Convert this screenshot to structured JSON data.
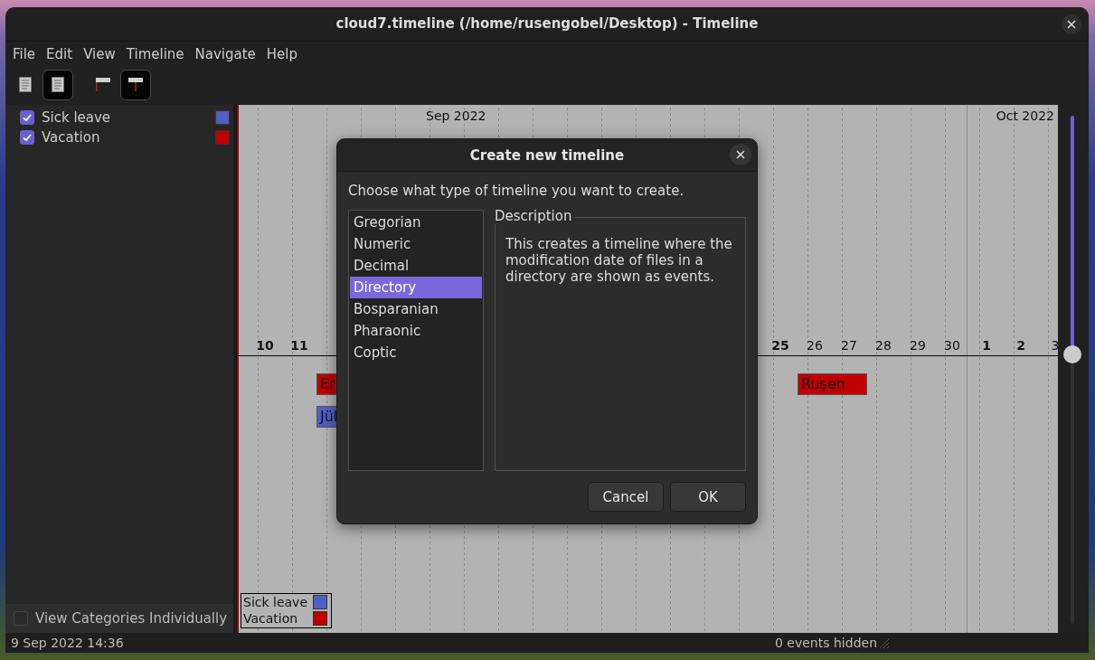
{
  "window": {
    "title": "cloud7.timeline (/home/rusengobel/Desktop) - Timeline"
  },
  "menu": [
    "File",
    "Edit",
    "View",
    "Timeline",
    "Navigate",
    "Help"
  ],
  "toolbar": [
    {
      "kind": "page",
      "pressed": false
    },
    {
      "kind": "page",
      "pressed": true
    },
    {
      "kind": "flag-left",
      "pressed": false
    },
    {
      "kind": "flag-center",
      "pressed": true
    }
  ],
  "categories": [
    {
      "name": "Sick leave",
      "checked": true,
      "color": "#5060c4"
    },
    {
      "name": "Vacation",
      "checked": true,
      "color": "#c00000"
    }
  ],
  "view_individually": {
    "label": "View Categories Individually",
    "checked": false
  },
  "timeline": {
    "months": [
      "Sep 2022",
      "Oct 2022"
    ],
    "days": [
      {
        "label": "10",
        "weekend": true
      },
      {
        "label": "11",
        "weekend": true
      },
      {
        "label": "25",
        "weekend": true
      },
      {
        "label": "26",
        "weekend": false
      },
      {
        "label": "27",
        "weekend": false
      },
      {
        "label": "28",
        "weekend": false
      },
      {
        "label": "29",
        "weekend": false
      },
      {
        "label": "30",
        "weekend": false
      },
      {
        "label": "1",
        "weekend": true
      },
      {
        "label": "2",
        "weekend": true
      },
      {
        "label": "3",
        "weekend": false
      }
    ],
    "events": [
      {
        "text": "Er",
        "color": "#c00000"
      },
      {
        "text": "Jül",
        "color": "#5060c4"
      },
      {
        "text": "Ruşen",
        "color": "#c00000"
      }
    ],
    "legend": [
      {
        "name": "Sick leave",
        "color": "#5060c4"
      },
      {
        "name": "Vacation",
        "color": "#c00000"
      }
    ]
  },
  "zoom": {
    "level": 0.47
  },
  "status_bar": {
    "left": "9 Sep 2022 14:36",
    "right": "0 events hidden"
  },
  "dialog": {
    "title": "Create new timeline",
    "prompt": "Choose what type of timeline you want to create.",
    "types": [
      {
        "label": "Gregorian",
        "selected": false
      },
      {
        "label": "Numeric",
        "selected": false
      },
      {
        "label": "Decimal",
        "selected": false
      },
      {
        "label": "Directory",
        "selected": true
      },
      {
        "label": "Bosparanian",
        "selected": false
      },
      {
        "label": "Pharaonic",
        "selected": false
      },
      {
        "label": "Coptic",
        "selected": false
      }
    ],
    "description_label": "Description",
    "description": "This creates a timeline where the modification date of files in a directory are shown as events.",
    "buttons": [
      "Cancel",
      "OK"
    ]
  }
}
